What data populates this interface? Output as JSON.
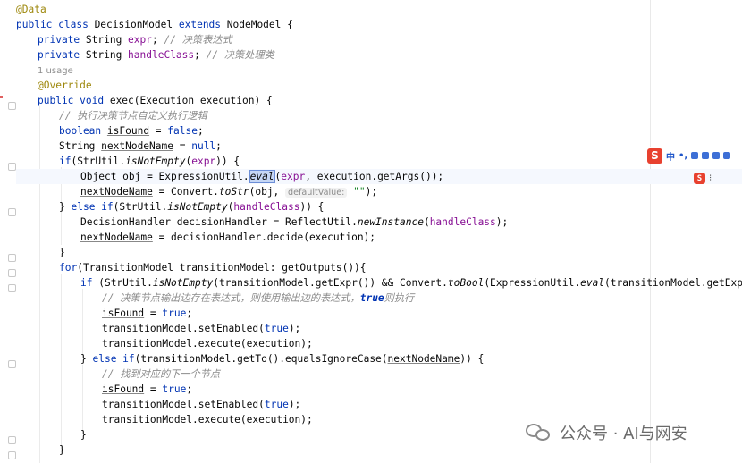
{
  "code": {
    "l1": {
      "ann": "@Data"
    },
    "l2": {
      "kw1": "public class",
      "name": " DecisionModel ",
      "kw2": "extends",
      "rest": " NodeModel {"
    },
    "l3": {
      "kw": "private",
      "type": " String ",
      "fld": "expr",
      "semi": "; ",
      "cm": "// 决策表达式"
    },
    "l4": {
      "kw": "private",
      "type": " String ",
      "fld": "handleClass",
      "semi": "; ",
      "cm": "// 决策处理类"
    },
    "l5": {
      "usage": "1 usage"
    },
    "l6": {
      "ann": "@Override"
    },
    "l7": {
      "kw": "public void",
      "rest": " exec(Execution execution) {"
    },
    "l8": {
      "cm": "// 执行决策节点自定义执行逻辑"
    },
    "l9": {
      "kw": "boolean",
      "sp": " ",
      "var": "isFound",
      "eq": " = ",
      "kw2": "false",
      "end": ";"
    },
    "l10": {
      "type": "String ",
      "var": "nextNodeName",
      "eq": " = ",
      "kw": "null",
      "end": ";"
    },
    "l11": {
      "kw": "if",
      "p1": "(StrUtil.",
      "m": "isNotEmpty",
      "p2": "(",
      "fld": "expr",
      "p3": ")) {"
    },
    "l12": {
      "p1": "Object obj = ExpressionUtil.",
      "sel": "eval",
      "p2": "(",
      "fld": "expr",
      "p3": ", execution.getArgs());"
    },
    "l13": {
      "var": "nextNodeName",
      "p1": " = Convert.",
      "m": "toStr",
      "p2": "(obj, ",
      "hint": "defaultValue:",
      "str": " \"\"",
      "end": ");"
    },
    "l14": {
      "p1": "} ",
      "kw": "else if",
      "p2": "(StrUtil.",
      "m": "isNotEmpty",
      "p3": "(",
      "fld": "handleClass",
      "p4": ")) {"
    },
    "l15": {
      "p1": "DecisionHandler decisionHandler = ReflectUtil.",
      "m": "newInstance",
      "p2": "(",
      "fld": "handleClass",
      "p3": ");"
    },
    "l16": {
      "var": "nextNodeName",
      "p1": " = decisionHandler.decide(execution);"
    },
    "l17": {
      "p1": "}"
    },
    "l18": {
      "kw": "for",
      "p1": "(TransitionModel transitionModel: getOutputs()){"
    },
    "l19": {
      "kw": "if",
      "p1": " (StrUtil.",
      "m": "isNotEmpty",
      "p2": "(transitionModel.getExpr()) && Convert.",
      "m2": "toBool",
      "p3": "(ExpressionUtil.",
      "m3": "eval",
      "p4": "(transitionModel.getExpr(), execution.g"
    },
    "l20": {
      "cm": "// 决策节点输出边存在表达式，则使用输出边的表达式，",
      "cmkw": "true",
      "cm2": "则执行"
    },
    "l21": {
      "var": "isFound",
      "eq": " = ",
      "kw": "true",
      "end": ";"
    },
    "l22": {
      "p1": "transitionModel.setEnabled(",
      "kw": "true",
      "p2": ");"
    },
    "l23": {
      "p1": "transitionModel.execute(execution);"
    },
    "l24": {
      "p1": "} ",
      "kw": "else if",
      "p2": "(transitionModel.getTo().equalsIgnoreCase(",
      "var": "nextNodeName",
      "p3": ")) {"
    },
    "l25": {
      "cm": "// 找到对应的下一个节点"
    },
    "l26": {
      "var": "isFound",
      "eq": " = ",
      "kw": "true",
      "end": ";"
    },
    "l27": {
      "p1": "transitionModel.setEnabled(",
      "kw": "true",
      "p2": ");"
    },
    "l28": {
      "p1": "transitionModel.execute(execution);"
    },
    "l29": {
      "p1": "}"
    },
    "l30": {
      "p1": "}"
    }
  },
  "ime_toolbar": {
    "logo": "S",
    "mode": "中"
  },
  "watermark": {
    "text": "公众号 · AI与网安"
  },
  "icons": [
    "lightbulb-icon",
    "fold-icon",
    "sogou-ime-icon",
    "wechat-icon"
  ],
  "colors": {
    "keyword": "#0033b3",
    "annotation": "#9e880d",
    "comment": "#8c8c8c",
    "field": "#871094",
    "string": "#067d17",
    "selection": "#c6d7f5"
  }
}
